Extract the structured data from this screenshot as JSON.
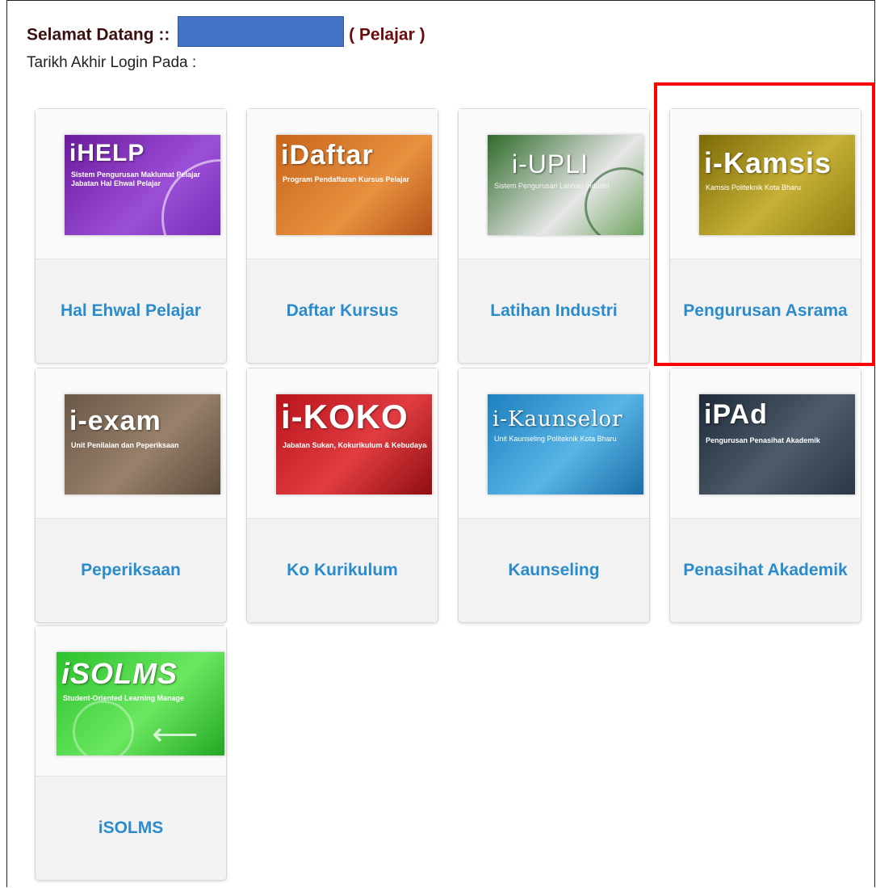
{
  "header": {
    "welcome_prefix": "Selamat Datang ::",
    "role": "( Pelajar )",
    "last_login_label": "Tarikh Akhir Login Pada :"
  },
  "tiles": [
    {
      "label": "Hal Ehwal Pelajar",
      "brand": "iHELP",
      "subtitle": "Sistem Pengurusan Maklumat Pelajar Jabatan Hal Ehwal Pelajar",
      "color": "#7a2db8"
    },
    {
      "label": "Daftar Kursus",
      "brand": "iDaftar",
      "subtitle": "Program Pendaftaran Kursus Pelajar",
      "color": "#d8782c"
    },
    {
      "label": "Latihan Industri",
      "brand": "i-UPLI",
      "subtitle": "Sistem Pengurusan Latihan Industri",
      "color": "#4a8a3c"
    },
    {
      "label": "Pengurusan Asrama",
      "brand": "i-Kamsis",
      "subtitle": "Kamsis Politeknik Kota Bharu",
      "color": "#b09a20"
    },
    {
      "label": "Peperiksaan",
      "brand": "i-exam",
      "subtitle": "Unit Penilaian dan Peperiksaan",
      "color": "#7d6856"
    },
    {
      "label": "Ko Kurikulum",
      "brand": "i-KOKO",
      "subtitle": "Jabatan Sukan, Kokurikulum & Kebudayaan",
      "color": "#c8202a"
    },
    {
      "label": "Kaunseling",
      "brand": "i-Kaunselor",
      "subtitle": "Unit Kaunseling Politeknik Kota Bharu",
      "color": "#2f95d3"
    },
    {
      "label": "Penasihat Akademik",
      "brand": "iPAd",
      "subtitle": "Pengurusan Penasihat Akademik",
      "color": "#34414f"
    },
    {
      "label": "iSOLMS",
      "brand": "iSOLMS",
      "subtitle": "Student-Oriented Learning Manage",
      "color": "#3fd43a"
    }
  ],
  "highlight_color": "#ff0000"
}
